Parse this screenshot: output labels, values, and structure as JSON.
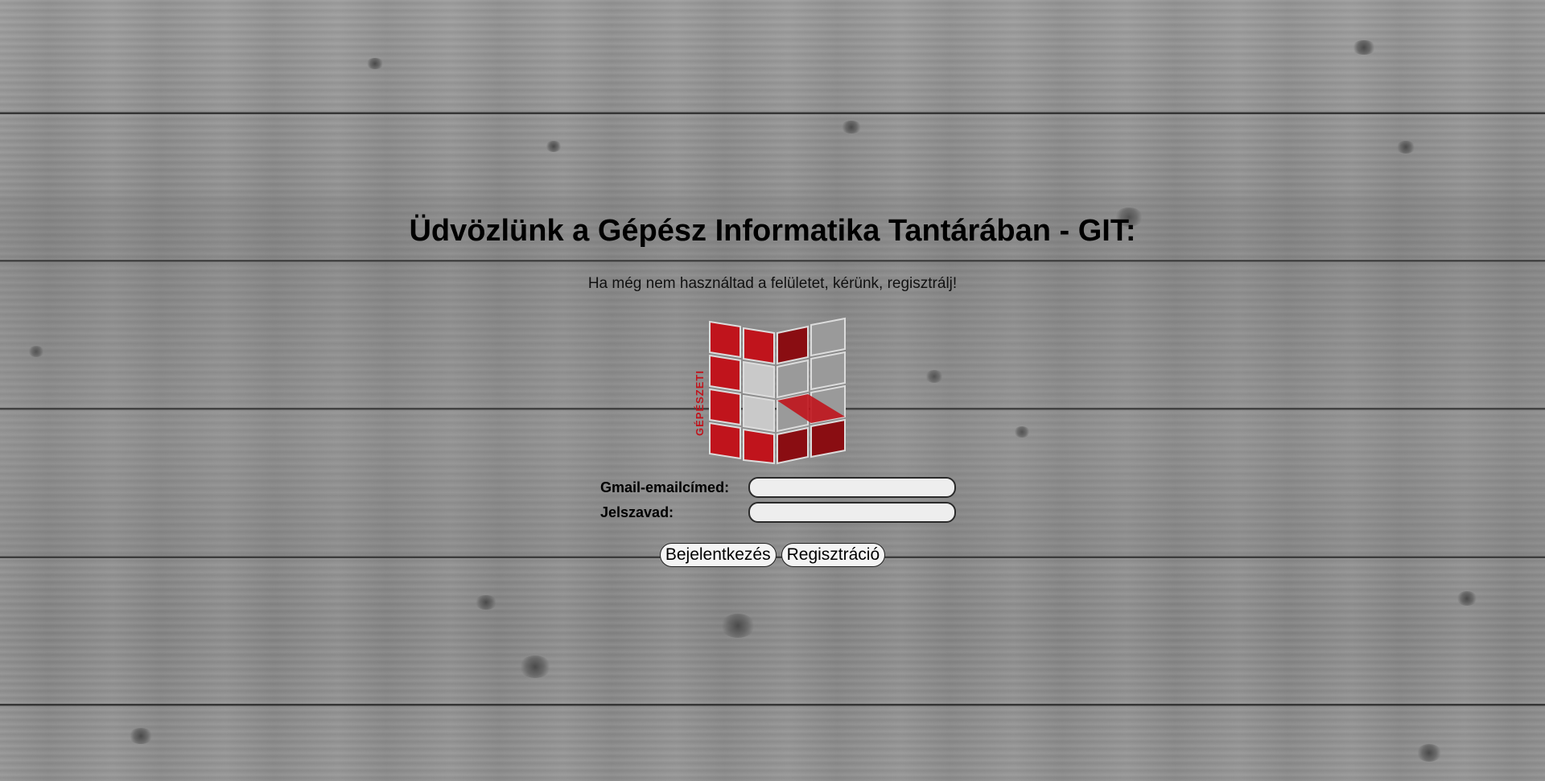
{
  "header": {
    "title": "Üdvözlünk a Gépész Informatika Tantárában - GIT:",
    "subtitle": "Ha még nem használtad a felületet, kérünk, regisztrálj!"
  },
  "logo": {
    "icon": "gepeszeti-logo-icon",
    "text": "GÉPÉSZETI",
    "colors": {
      "red": "#c0141c",
      "dark_red": "#8a0d12",
      "light_gray": "#c9c9c9",
      "gray": "#9a9a9a"
    }
  },
  "form": {
    "email_label": "Gmail-emailcímed:",
    "email_value": "",
    "password_label": "Jelszavad:",
    "password_value": ""
  },
  "buttons": {
    "login_label": "Bejelentkezés",
    "register_label": "Regisztráció"
  }
}
